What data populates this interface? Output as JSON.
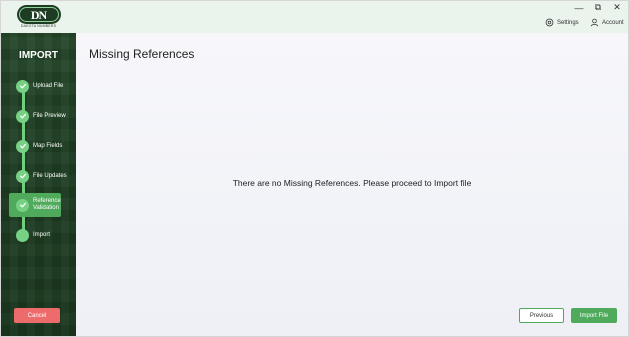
{
  "app": {
    "logo_letters": "DN",
    "logo_caption": "DAKOTA NUMBERS"
  },
  "window_controls": {
    "minimize": "—",
    "restore": "⧉",
    "close": "✕"
  },
  "topbar": {
    "settings_label": "Settings",
    "account_label": "Account"
  },
  "sidebar": {
    "title": "IMPORT",
    "steps": [
      {
        "label": "Upload File",
        "state": "complete"
      },
      {
        "label": "File Preview",
        "state": "complete"
      },
      {
        "label": "Map Fields",
        "state": "complete"
      },
      {
        "label": "File Updates",
        "state": "complete"
      },
      {
        "label": "Reference Validation",
        "state": "active"
      },
      {
        "label": "Import",
        "state": "pending"
      }
    ],
    "cancel_label": "Cancel"
  },
  "main": {
    "title": "Missing References",
    "message": "There are no Missing References. Please proceed to Import file",
    "previous_label": "Previous",
    "import_label": "Import File"
  },
  "colors": {
    "sidebar_bg": "#1f3f24",
    "accent_green": "#4faa5c",
    "check_green": "#76d184",
    "cancel_red": "#ee6b6b",
    "topbar_bg": "#eaf3ec"
  }
}
